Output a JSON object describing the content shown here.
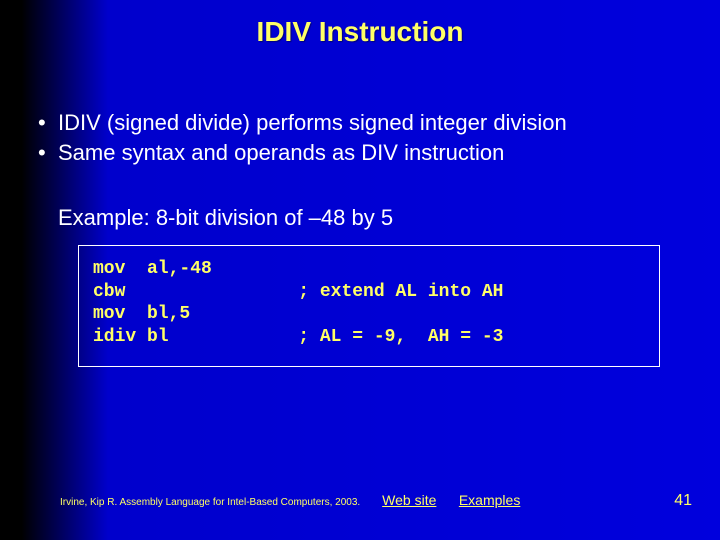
{
  "title": "IDIV Instruction",
  "bullets": [
    "IDIV (signed divide) performs signed integer division",
    "Same syntax and operands as DIV instruction"
  ],
  "example_label": "Example: 8-bit division of –48 by 5",
  "code": {
    "l1": "mov  al,-48",
    "l2": "cbw                ; extend AL into AH",
    "l3": "mov  bl,5",
    "l4": "idiv bl            ; AL = -9,  AH = -3"
  },
  "footer": {
    "citation": "Irvine, Kip R. Assembly Language for Intel-Based Computers, 2003.",
    "link1": "Web site",
    "link2": "Examples",
    "page": "41"
  }
}
